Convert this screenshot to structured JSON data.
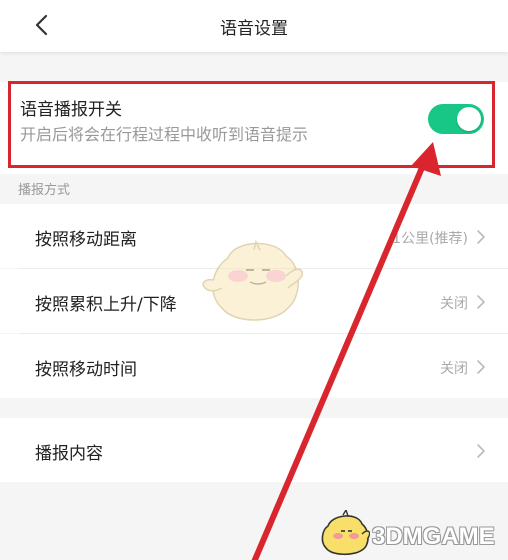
{
  "header": {
    "title": "语音设置",
    "back_icon": "chevron-left-icon"
  },
  "toggle": {
    "title": "语音播报开关",
    "description": "开启后将会在行程过程中收听到语音提示",
    "enabled": true,
    "color": "#18c786"
  },
  "section": {
    "label": "播报方式"
  },
  "rows": [
    {
      "label": "按照移动距离",
      "value": "1公里(推荐)"
    },
    {
      "label": "按照累积上升/下降",
      "value": "关闭"
    },
    {
      "label": "按照移动时间",
      "value": "关闭"
    }
  ],
  "content_row": {
    "label": "播报内容"
  },
  "annotation": {
    "color": "#d9262e"
  },
  "watermark": {
    "text": "3DMGAME"
  }
}
